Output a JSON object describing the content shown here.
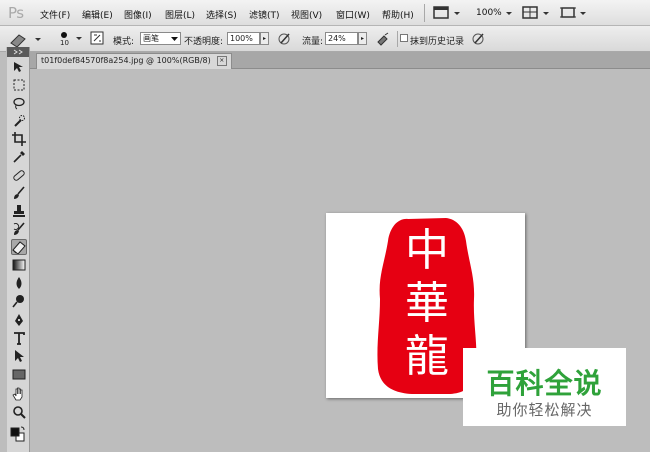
{
  "app": {
    "logo": "Ps"
  },
  "menu": {
    "items": [
      {
        "label": "文件(F)"
      },
      {
        "label": "编辑(E)"
      },
      {
        "label": "图像(I)"
      },
      {
        "label": "图层(L)"
      },
      {
        "label": "选择(S)"
      },
      {
        "label": "滤镜(T)"
      },
      {
        "label": "视图(V)"
      },
      {
        "label": "窗口(W)"
      },
      {
        "label": "帮助(H)"
      }
    ],
    "zoom": "100%"
  },
  "options": {
    "brush_size": "10",
    "mode_label": "模式:",
    "mode_value": "画笔",
    "opacity_label": "不透明度:",
    "opacity_value": "100%",
    "flow_label": "流量:",
    "flow_value": "24%",
    "history_label": "抹到历史记录",
    "history_checked": false
  },
  "document": {
    "tab_title": "t01f0def84570f8a254.jpg @ 100%(RGB/8)",
    "close_glyph": "×",
    "seal_text": [
      "中",
      "華",
      "龍"
    ],
    "seal_color": "#e60012"
  },
  "watermark": {
    "title": "百科全说",
    "subtitle": "助你轻松解决",
    "title_color": "#2fa23a"
  },
  "tools": [
    "move-tool",
    "marquee-tool",
    "lasso-tool",
    "quick-selection-tool",
    "crop-tool",
    "eyedropper-tool",
    "spot-healing-tool",
    "brush-tool",
    "clone-stamp-tool",
    "history-brush-tool",
    "eraser-tool",
    "gradient-tool",
    "blur-tool",
    "dodge-tool",
    "pen-tool",
    "type-tool",
    "path-selection-tool",
    "rectangle-tool",
    "hand-tool",
    "zoom-tool",
    "color-swatches"
  ],
  "active_tool": "eraser-tool"
}
